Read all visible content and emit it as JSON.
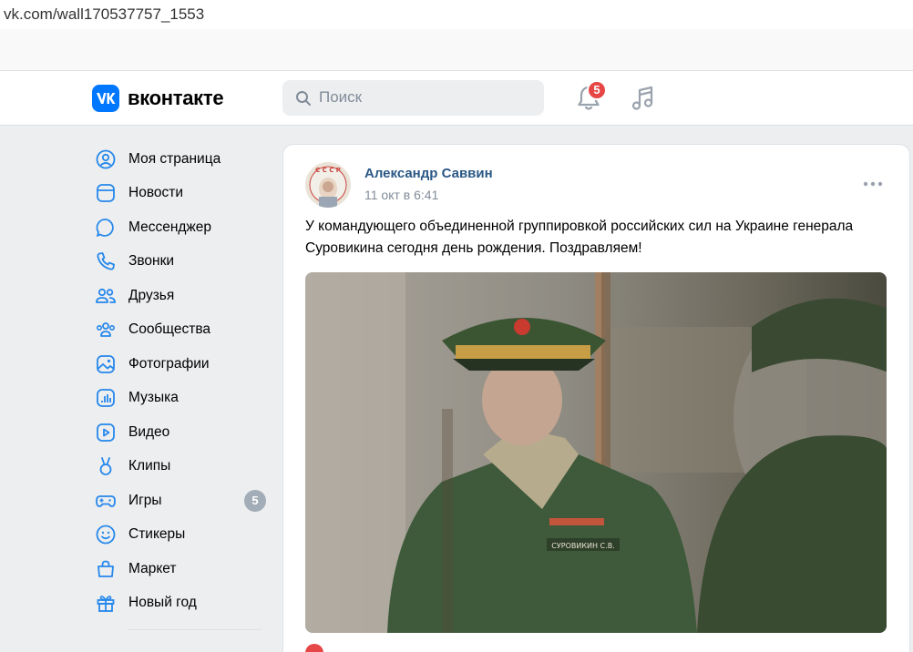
{
  "browser": {
    "url": "vk.com/wall170537757_1553"
  },
  "header": {
    "logo_text": "вконтакте",
    "search_placeholder": "Поиск",
    "notifications_count": "5"
  },
  "sidebar": {
    "items": [
      {
        "label": "Моя страница",
        "icon": "user-circle-icon"
      },
      {
        "label": "Новости",
        "icon": "news-icon"
      },
      {
        "label": "Мессенджер",
        "icon": "messenger-icon"
      },
      {
        "label": "Звонки",
        "icon": "phone-icon"
      },
      {
        "label": "Друзья",
        "icon": "friends-icon"
      },
      {
        "label": "Сообщества",
        "icon": "communities-icon"
      },
      {
        "label": "Фотографии",
        "icon": "photos-icon"
      },
      {
        "label": "Музыка",
        "icon": "music-icon"
      },
      {
        "label": "Видео",
        "icon": "video-icon"
      },
      {
        "label": "Клипы",
        "icon": "clips-icon"
      },
      {
        "label": "Игры",
        "icon": "gamepad-icon",
        "count": "5"
      },
      {
        "label": "Стикеры",
        "icon": "sticker-icon"
      },
      {
        "label": "Маркет",
        "icon": "market-bag-icon"
      },
      {
        "label": "Новый год",
        "icon": "gift-icon"
      }
    ]
  },
  "post": {
    "author": "Александр Саввин",
    "date": "11 окт в 6:41",
    "text": "У командующего объединенной группировкой российских сил на Украине генерала Суровикина сегодня день рождения. Поздравляем!",
    "avatar_letters": "СССР",
    "photo_nametag": "СУРОВИКИН С.В."
  },
  "colors": {
    "accent": "#0077ff",
    "link": "#2a5885",
    "badge": "#e64646",
    "secondary_text": "#818c99",
    "page_bg": "#edeef0"
  }
}
